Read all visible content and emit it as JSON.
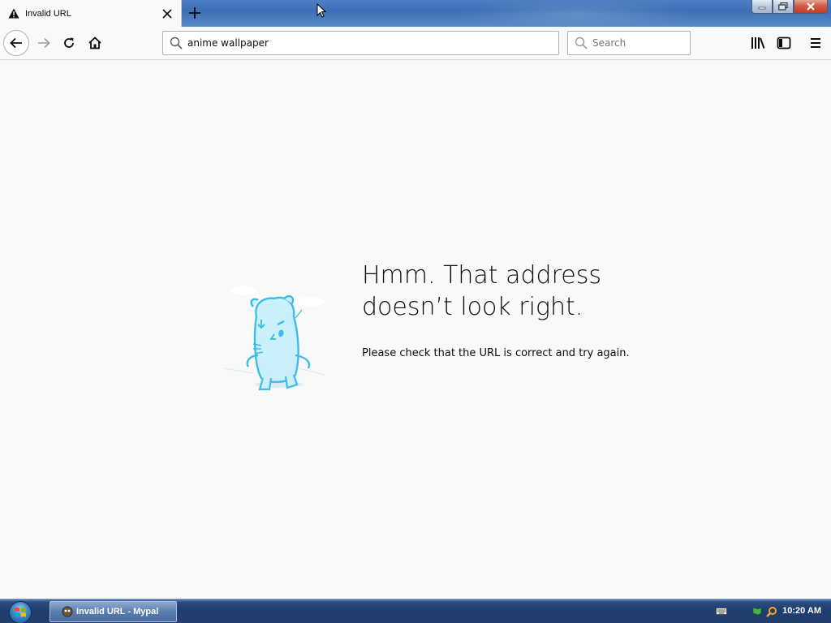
{
  "tab": {
    "title": "Invalid URL",
    "icon": "warning-icon",
    "close_icon": "close-icon"
  },
  "new_tab_icon": "plus-icon",
  "window_controls": [
    "minimize-icon",
    "restore-icon",
    "close-icon"
  ],
  "navbar": {
    "back_icon": "back-arrow-icon",
    "forward_icon": "forward-arrow-icon",
    "reload_icon": "reload-icon",
    "home_icon": "home-icon",
    "url_value": "anime wallpaper",
    "search_placeholder": "Search",
    "library_icon": "library-icon",
    "sidebar_icon": "sidebar-icon",
    "menu_icon": "hamburger-menu-icon"
  },
  "error_page": {
    "title_line1": "Hmm. That address",
    "title_line2": "doesn’t look right.",
    "description": "Please check that the URL is correct and try again.",
    "illustration": "confused-hamster-illustration"
  },
  "taskbar": {
    "start_icon": "windows-start-orb-icon",
    "task_label": "Invalid URL - Mypal",
    "clock": "10:20 AM"
  },
  "colors": {
    "accent_blue": "#3d6db5",
    "page_bg": "#f9f9fa",
    "illustration_blue": "#3fbde8",
    "text": "#0c0c0d"
  }
}
